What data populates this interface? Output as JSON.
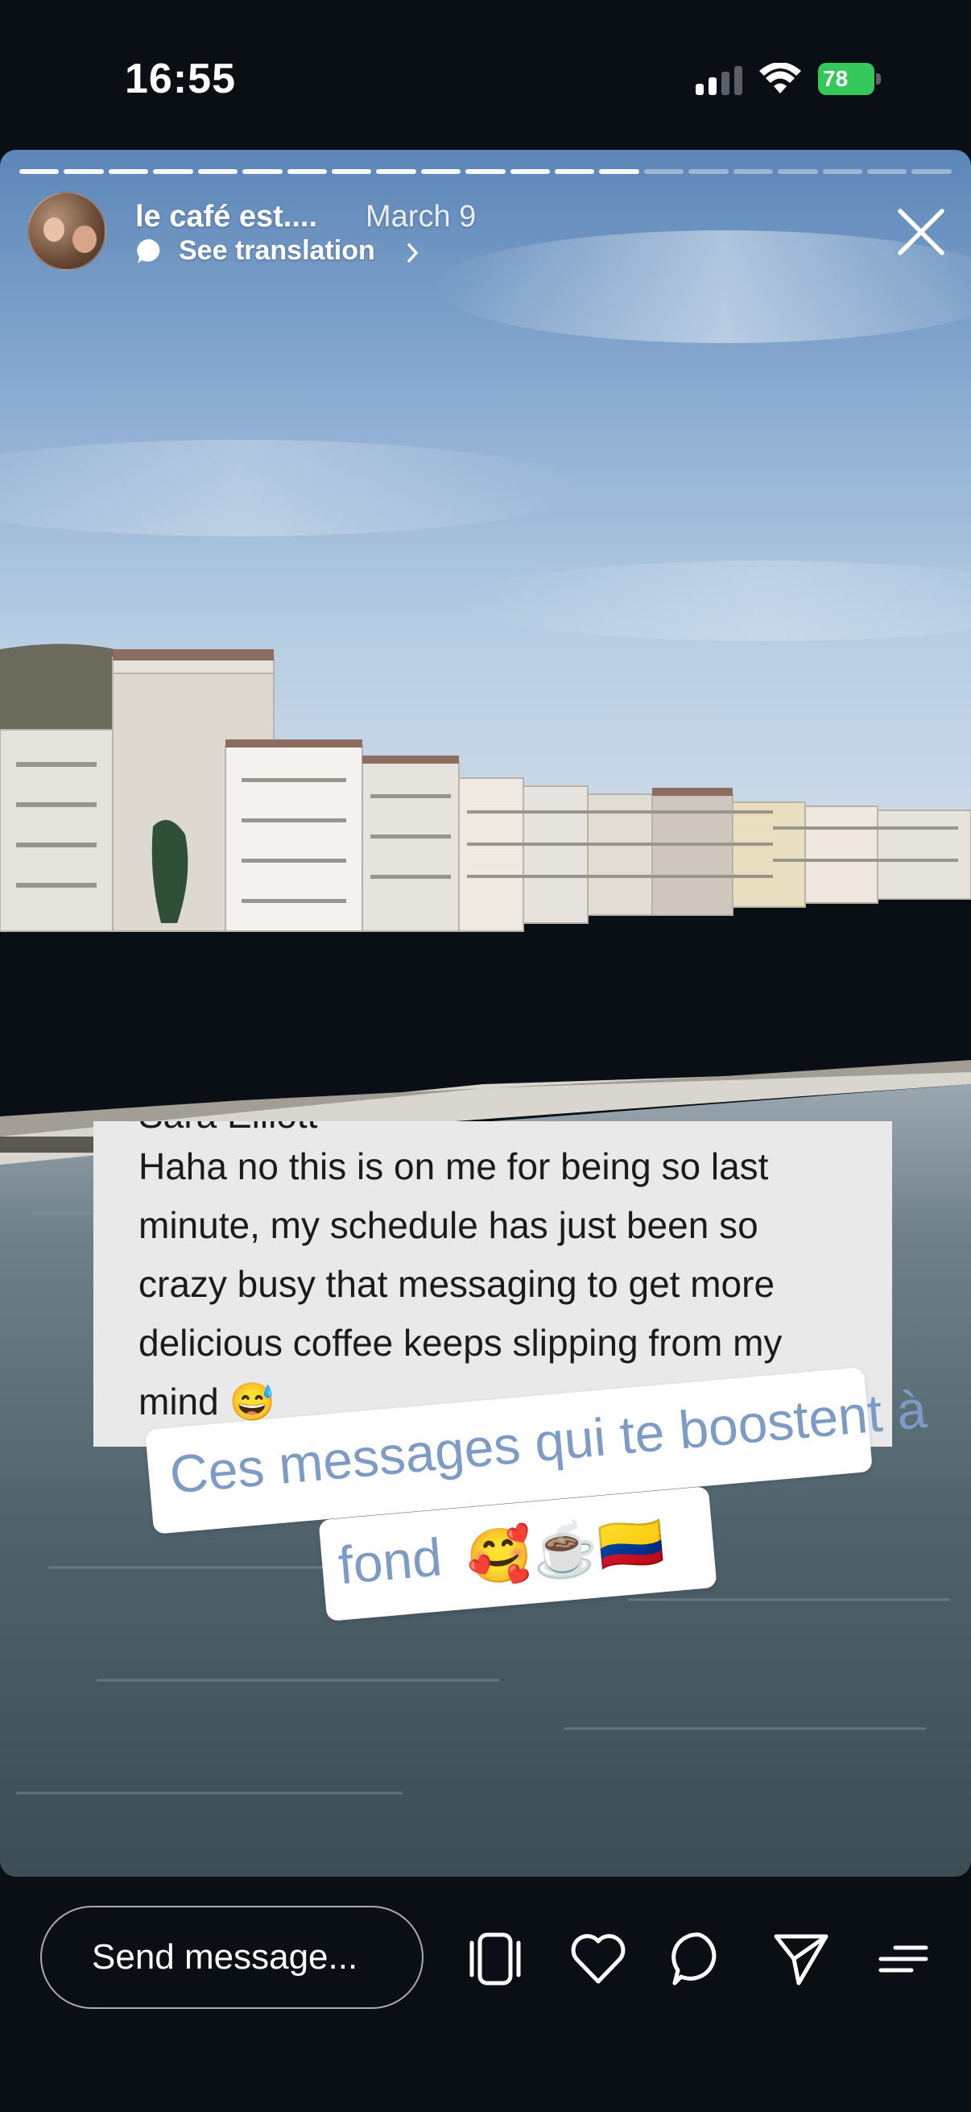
{
  "status_bar": {
    "time": "16:55",
    "battery_level": "78"
  },
  "story": {
    "progress": {
      "total_segments": 21,
      "current_segment": 14
    },
    "author": {
      "username": "le café est....",
      "date": "March 9"
    },
    "translation_link": "See translation",
    "screenshot_message": {
      "lines": [
        "Haha no this is on me for being so last",
        "minute, my schedule has just been so",
        "crazy busy that messaging to get more",
        "delicious coffee keeps slipping from my",
        "mind 😅"
      ]
    },
    "caption": {
      "line1": "Ces messages qui te boostent à",
      "line2": "fond",
      "emojis": "🥰☕🇨🇴"
    }
  },
  "bottom_bar": {
    "message_placeholder": "Send message..."
  },
  "icons": {
    "close": "close-icon",
    "translation": "speech-bubble-icon",
    "reshare": "reshare-frame-icon",
    "like": "heart-icon",
    "comment": "comment-bubble-icon",
    "share": "send-paper-plane-icon",
    "more": "menu-lines-icon"
  },
  "colors": {
    "background": "#0a0f16",
    "battery": "#34c759",
    "caption_text": "#7e9bc6",
    "message_bg": "#e9e9e9"
  }
}
